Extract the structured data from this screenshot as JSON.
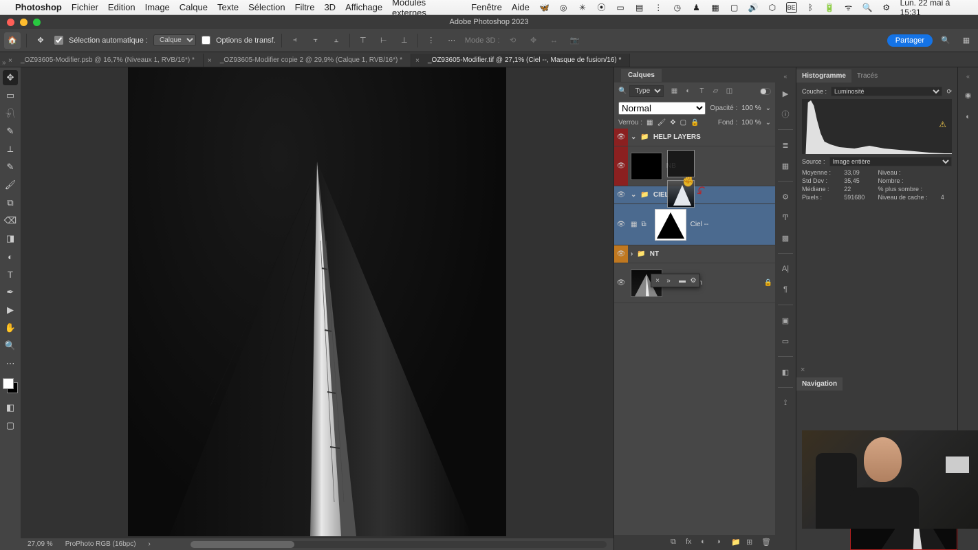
{
  "menubar": {
    "app": "Photoshop",
    "items": [
      "Fichier",
      "Edition",
      "Image",
      "Calque",
      "Texte",
      "Sélection",
      "Filtre",
      "3D",
      "Affichage",
      "Modules externes",
      "Fenêtre",
      "Aide"
    ],
    "clock": "Lun. 22 mai à 15:31",
    "be_icon": "BE"
  },
  "window_title": "Adobe Photoshop 2023",
  "optbar": {
    "auto_select_label": "Sélection automatique :",
    "auto_select_target": "Calque",
    "transform_label": "Options de transf.",
    "mode3d_label": "Mode 3D :",
    "share": "Partager"
  },
  "tabs": [
    {
      "label": "_OZ93605-Modifier.psb @ 16,7% (Niveaux 1, RVB/16*) *",
      "active": false
    },
    {
      "label": "_OZ93605-Modifier copie 2 @ 29,9% (Calque 1, RVB/16*) *",
      "active": false
    },
    {
      "label": "_OZ93605-Modifier.tif @ 27,1% (Ciel --, Masque de fusion/16) *",
      "active": true
    }
  ],
  "layers_panel": {
    "tab": "Calques",
    "filter_label": "Type",
    "blend_mode": "Normal",
    "opacity_label": "Opacité :",
    "opacity_value": "100 %",
    "lock_label": "Verrou :",
    "fill_label": "Fond :",
    "fill_value": "100 %",
    "layers": [
      {
        "type": "group",
        "name": "HELP LAYERS",
        "eye": "red"
      },
      {
        "type": "layer",
        "name": "NB",
        "eye": "red"
      },
      {
        "type": "group",
        "name": "CIEL",
        "eye": true,
        "selected": true,
        "masked": true
      },
      {
        "type": "layer",
        "name": "Ciel --",
        "eye": true,
        "selected": true,
        "has_mask": true
      },
      {
        "type": "group",
        "name": "NT",
        "eye": "orange"
      },
      {
        "type": "layer",
        "name": "Arrière-plan",
        "eye": true,
        "locked": true
      }
    ]
  },
  "histogram": {
    "tabs": [
      "Histogramme",
      "Tracés"
    ],
    "channel_label": "Couche :",
    "channel_value": "Luminosité",
    "source_label": "Source :",
    "source_value": "Image entière",
    "stats": {
      "moyenne_label": "Moyenne :",
      "moyenne": "33,09",
      "niveau_label": "Niveau :",
      "niveau": "",
      "stddev_label": "Std Dev :",
      "stddev": "35,45",
      "nombre_label": "Nombre :",
      "nombre": "",
      "mediane_label": "Médiane :",
      "mediane": "22",
      "pctsombre_label": "% plus sombre :",
      "pctsombre": "",
      "pixels_label": "Pixels :",
      "pixels": "591680",
      "cache_label": "Niveau de cache :",
      "cache": "4"
    }
  },
  "navigation": {
    "tab": "Navigation"
  },
  "status": {
    "zoom": "27,09 %",
    "profile": "ProPhoto RGB (16bpc)"
  }
}
